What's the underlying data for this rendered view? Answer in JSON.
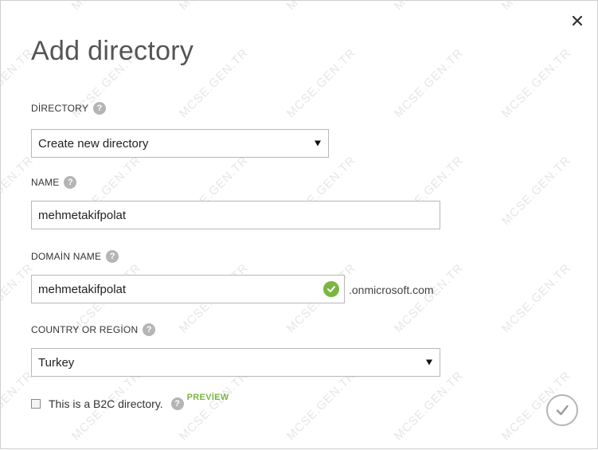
{
  "dialog": {
    "title": "Add directory",
    "close_icon": "close-icon"
  },
  "directory": {
    "label": "DİRECTORY",
    "selected": "Create new directory"
  },
  "name": {
    "label": "NAME",
    "value": "mehmetakifpolat"
  },
  "domain_name": {
    "label": "DOMAİN NAME",
    "value": "mehmetakifpolat",
    "suffix": ".onmicrosoft.com",
    "status_icon": "check-circle-icon",
    "status_color": "#7bb642"
  },
  "country": {
    "label": "COUNTRY OR REGİON",
    "selected": "Turkey"
  },
  "b2c": {
    "label": "This is a B2C directory.",
    "checked": false,
    "badge": "PREVİEW"
  },
  "help_glyph": "?",
  "watermark_text": "MCSE.GEN.TR",
  "confirm": {
    "icon": "checkmark-icon"
  }
}
